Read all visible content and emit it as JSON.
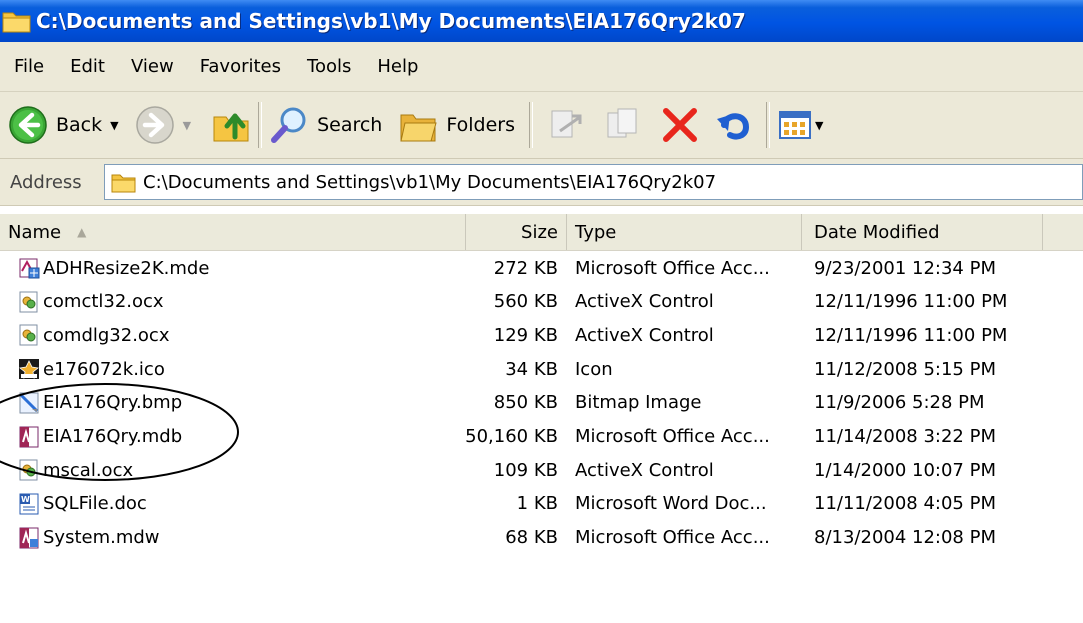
{
  "window": {
    "title": "C:\\Documents and Settings\\vb1\\My Documents\\EIA176Qry2k07"
  },
  "menu": [
    "File",
    "Edit",
    "View",
    "Favorites",
    "Tools",
    "Help"
  ],
  "toolbar": {
    "back_label": "Back",
    "search_label": "Search",
    "folders_label": "Folders"
  },
  "address": {
    "label": "Address",
    "value": "C:\\Documents and Settings\\vb1\\My Documents\\EIA176Qry2k07"
  },
  "columns": {
    "name": "Name",
    "size": "Size",
    "type": "Type",
    "date": "Date Modified"
  },
  "files": [
    {
      "name": "ADHResize2K.mde",
      "size": "272 KB",
      "type": "Microsoft Office Acc...",
      "date": "9/23/2001 12:34 PM",
      "icon": "access-mde-icon"
    },
    {
      "name": "comctl32.ocx",
      "size": "560 KB",
      "type": "ActiveX Control",
      "date": "12/11/1996 11:00 PM",
      "icon": "activex-icon"
    },
    {
      "name": "comdlg32.ocx",
      "size": "129 KB",
      "type": "ActiveX Control",
      "date": "12/11/1996 11:00 PM",
      "icon": "activex-icon"
    },
    {
      "name": "e176072k.ico",
      "size": "34 KB",
      "type": "Icon",
      "date": "11/12/2008 5:15 PM",
      "icon": "ico-file-icon"
    },
    {
      "name": "EIA176Qry.bmp",
      "size": "850 KB",
      "type": "Bitmap Image",
      "date": "11/9/2006 5:28 PM",
      "icon": "bitmap-icon"
    },
    {
      "name": "EIA176Qry.mdb",
      "size": "50,160 KB",
      "type": "Microsoft Office Acc...",
      "date": "11/14/2008 3:22 PM",
      "icon": "access-mdb-icon"
    },
    {
      "name": "mscal.ocx",
      "size": "109 KB",
      "type": "ActiveX Control",
      "date": "1/14/2000 10:07 PM",
      "icon": "activex-icon"
    },
    {
      "name": "SQLFile.doc",
      "size": "1 KB",
      "type": "Microsoft Word Doc...",
      "date": "11/11/2008 4:05 PM",
      "icon": "word-doc-icon"
    },
    {
      "name": "System.mdw",
      "size": "68 KB",
      "type": "Microsoft Office Acc...",
      "date": "8/13/2004 12:08 PM",
      "icon": "access-mdw-icon"
    }
  ],
  "colors": {
    "titlebar": "#0054e3",
    "chrome": "#ece9d8",
    "delete_red": "#e8261c",
    "folder_yellow": "#f5c542"
  }
}
